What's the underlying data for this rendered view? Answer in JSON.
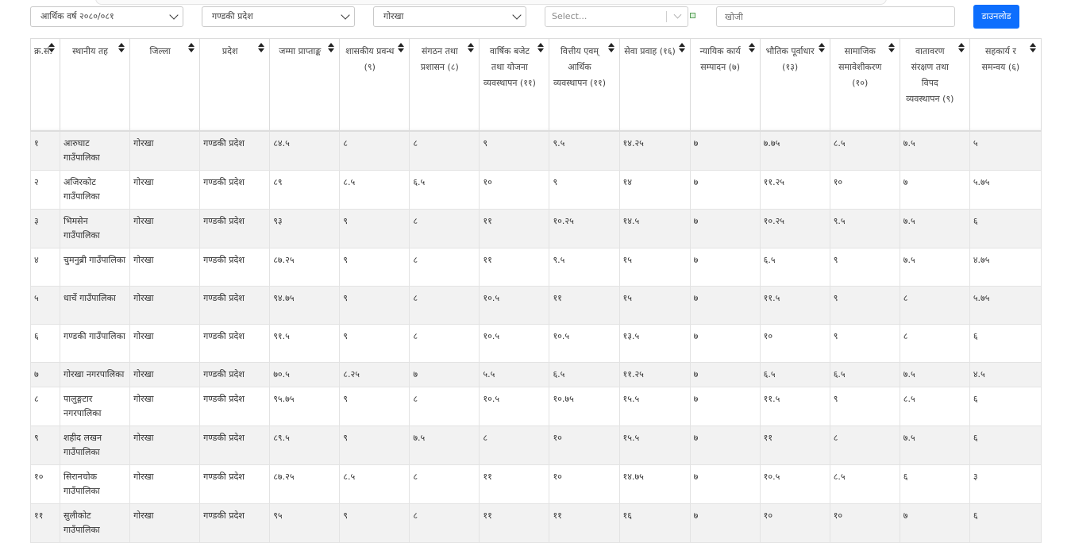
{
  "filters": {
    "fiscal_year": "आर्थिक वर्ष २०८०/०८१",
    "province": "गण्डकी प्रदेश",
    "district": "गोरखा",
    "multiselect_placeholder": "Select...",
    "search_placeholder": "खोजी",
    "download_label": "डाउनलोड"
  },
  "table": {
    "headers": [
      "क्र.सं.",
      "स्थानीय तह",
      "जिल्ला",
      "प्रदेश",
      "जम्मा प्राप्ताङ्क",
      "शासकीय प्रवन्ध (९)",
      "संगठन तथा प्रशासन (८)",
      "वार्षिक बजेट तथा योजना व्यवस्थापन (११)",
      "वित्तीय एवम् आर्थिक व्यवस्थापन (११)",
      "सेवा प्रवाह (१६)",
      "न्यायिक कार्य सम्पादन (७)",
      "भौतिक पूर्वाधार (१३)",
      "सामाजिक समावेशीकरण (१०)",
      "वातावरण संरक्षण तथा विपद व्यवस्थापन (९)",
      "सहकार्य र समन्वय (६)"
    ],
    "rows": [
      [
        "१",
        "आरुघाट गाउँपालिका",
        "गोरखा",
        "गण्डकी प्रदेश",
        "८४.५",
        "८",
        "८",
        "९",
        "९.५",
        "१४.२५",
        "७",
        "७.७५",
        "८.५",
        "७.५",
        "५"
      ],
      [
        "२",
        "अजिरकोट गाउँपालिका",
        "गोरखा",
        "गण्डकी प्रदेश",
        "८९",
        "८.५",
        "६.५",
        "१०",
        "९",
        "१४",
        "७",
        "११.२५",
        "१०",
        "७",
        "५.७५"
      ],
      [
        "३",
        "भिमसेन गाउँपालिका",
        "गोरखा",
        "गण्डकी प्रदेश",
        "९३",
        "९",
        "८",
        "११",
        "१०.२५",
        "१४.५",
        "७",
        "१०.२५",
        "९.५",
        "७.५",
        "६"
      ],
      [
        "४",
        "चुमनुब्री गाउँपालिका",
        "गोरखा",
        "गण्डकी प्रदेश",
        "८७.२५",
        "९",
        "८",
        "११",
        "९.५",
        "१५",
        "७",
        "६.५",
        "९",
        "७.५",
        "४.७५"
      ],
      [
        "५",
        "धार्चे गाउँपालिका",
        "गोरखा",
        "गण्डकी प्रदेश",
        "९४.७५",
        "९",
        "८",
        "१०.५",
        "११",
        "१५",
        "७",
        "११.५",
        "९",
        "८",
        "५.७५"
      ],
      [
        "६",
        "गण्डकी गाउँपालिका",
        "गोरखा",
        "गण्डकी प्रदेश",
        "९१.५",
        "९",
        "८",
        "१०.५",
        "१०.५",
        "१३.५",
        "७",
        "१०",
        "९",
        "८",
        "६"
      ],
      [
        "७",
        "गोरखा नगरपालिका",
        "गोरखा",
        "गण्डकी प्रदेश",
        "७०.५",
        "८.२५",
        "७",
        "५.५",
        "६.५",
        "११.२५",
        "७",
        "६.५",
        "६.५",
        "७.५",
        "४.५"
      ],
      [
        "८",
        "पालुङ्गटार नगरपालिका",
        "गोरखा",
        "गण्डकी प्रदेश",
        "९५.७५",
        "९",
        "८",
        "१०.५",
        "१०.७५",
        "१५.५",
        "७",
        "११.५",
        "९",
        "८.५",
        "६"
      ],
      [
        "९",
        "शहीद लखन गाउँपालिका",
        "गोरखा",
        "गण्डकी प्रदेश",
        "८९.५",
        "९",
        "७.५",
        "८",
        "१०",
        "१५.५",
        "७",
        "११",
        "८",
        "७.५",
        "६"
      ],
      [
        "१०",
        "सिरानचोक गाउँपालिका",
        "गोरखा",
        "गण्डकी प्रदेश",
        "८७.२५",
        "८.५",
        "८",
        "११",
        "१०",
        "१४.७५",
        "७",
        "१०.५",
        "८.५",
        "६",
        "३"
      ],
      [
        "११",
        "सुलीकोट गाउँपालिका",
        "गोरखा",
        "गण्डकी प्रदेश",
        "९५",
        "९",
        "८",
        "११",
        "११",
        "१६",
        "७",
        "१०",
        "१०",
        "७",
        "६"
      ]
    ]
  }
}
